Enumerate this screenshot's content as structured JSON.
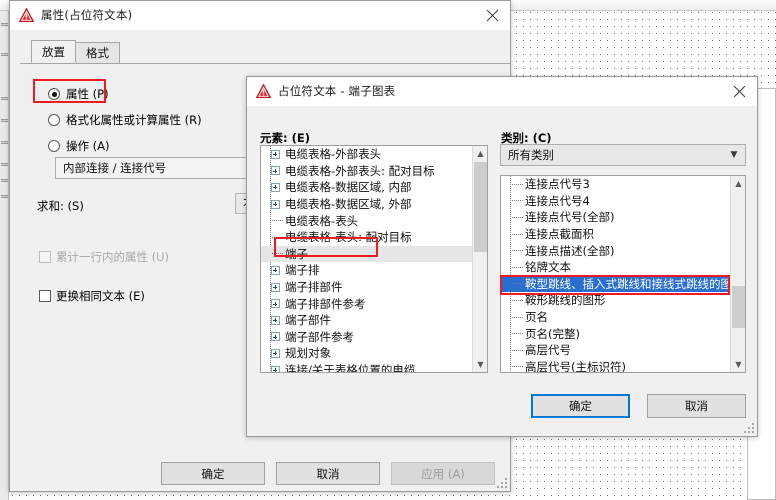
{
  "background": {
    "name": "cad-drawing-canvas"
  },
  "properties_dialog": {
    "title": "属性(占位符文本)",
    "title_icon": "warning-triangle-icon",
    "close_icon": "close-icon",
    "tabs": [
      {
        "label": "放置",
        "active": true
      },
      {
        "label": "格式",
        "active": false
      }
    ],
    "radios": [
      {
        "label": "属性 (P)",
        "checked": true
      },
      {
        "label": "格式化属性或计算属性 (R)",
        "checked": false
      },
      {
        "label": "操作 (A)",
        "checked": false
      }
    ],
    "attribute_value": "内部连接 / 连接代号",
    "sum_label": "求和: (S)",
    "sum_value": "不求和",
    "checkboxes": [
      {
        "label": "累计一行内的属性 (U)",
        "checked": false,
        "disabled": true
      },
      {
        "label": "更换相同文本 (E)",
        "checked": false,
        "disabled": false
      }
    ],
    "buttons": {
      "ok": "确定",
      "cancel": "取消",
      "apply": "应用 (A)"
    }
  },
  "placeholder_dialog": {
    "title": "占位符文本 - 端子图表",
    "title_icon": "warning-triangle-icon",
    "close_icon": "close-icon",
    "elements_label": "元素: (E)",
    "category_label": "类别: (C)",
    "category_value": "所有类别",
    "category_arrow_icon": "chevron-down-icon",
    "elements_tree": [
      {
        "label": "电缆表格-外部表头",
        "expandable": true,
        "selected": false
      },
      {
        "label": "电缆表格-外部表头: 配对目标",
        "expandable": true,
        "selected": false
      },
      {
        "label": "电缆表格-数据区域, 内部",
        "expandable": true,
        "selected": false
      },
      {
        "label": "电缆表格-数据区域, 外部",
        "expandable": true,
        "selected": false
      },
      {
        "label": "电缆表格-表头",
        "expandable": false,
        "selected": false
      },
      {
        "label": "电缆表格-表头: 配对目标",
        "expandable": false,
        "selected": false
      },
      {
        "label": "端子",
        "expandable": false,
        "selected": true
      },
      {
        "label": "端子排",
        "expandable": true,
        "selected": false
      },
      {
        "label": "端子排部件",
        "expandable": true,
        "selected": false
      },
      {
        "label": "端子排部件参考",
        "expandable": true,
        "selected": false
      },
      {
        "label": "端子部件",
        "expandable": true,
        "selected": false
      },
      {
        "label": "端子部件参考",
        "expandable": true,
        "selected": false
      },
      {
        "label": "规划对象",
        "expandable": true,
        "selected": false
      },
      {
        "label": "连接/关于表格位置的电缆",
        "expandable": true,
        "selected": false
      }
    ],
    "category_list": [
      {
        "label": "连接点代号3",
        "selected": false
      },
      {
        "label": "连接点代号4",
        "selected": false
      },
      {
        "label": "连接点代号(全部)",
        "selected": false
      },
      {
        "label": "连接点截面积",
        "selected": false
      },
      {
        "label": "连接点描述(全部)",
        "selected": false
      },
      {
        "label": "铭牌文本",
        "selected": false
      },
      {
        "label": "鞍型跳线、插入式跳线和接线式跳线的图形",
        "selected": true
      },
      {
        "label": "鞍形跳线的图形",
        "selected": false
      },
      {
        "label": "页名",
        "selected": false
      },
      {
        "label": "页名(完整)",
        "selected": false
      },
      {
        "label": "高层代号",
        "selected": false
      },
      {
        "label": "高层代号(主标识符)",
        "selected": false
      }
    ],
    "buttons": {
      "ok": "确定",
      "cancel": "取消"
    }
  },
  "annotations": {
    "highlight_color": "#ee1c22",
    "boxes": [
      {
        "name": "radio-attribute-highlight"
      },
      {
        "name": "tree-item-terminal-highlight"
      },
      {
        "name": "category-item-jumper-highlight"
      }
    ]
  }
}
